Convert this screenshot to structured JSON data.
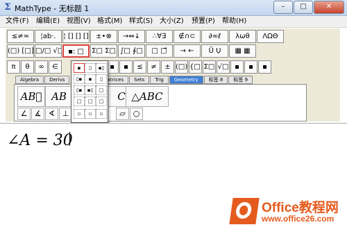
{
  "window": {
    "app_icon": "Σ",
    "title": "MathType - 无标题 1",
    "controls": [
      "–",
      "□",
      "✕"
    ]
  },
  "menu": [
    "文件(F)",
    "编辑(E)",
    "视图(V)",
    "格式(M)",
    "样式(S)",
    "大小(Z)",
    "预置(P)",
    "帮助(H)"
  ],
  "toolbar": {
    "row1": [
      "≤≠≈",
      "¦ab·.",
      "¦ [] [] [] ",
      "±•⊗",
      "→⇔↓",
      "∴∀∃",
      "∉∩⊂",
      "∂∞ℓ",
      "λωθ",
      "ΛΩΘ"
    ],
    "row2": [
      "(□) [□]",
      "□/□ √□",
      "▪: □",
      "Σ□ Σ□",
      "∫□ ∮□",
      "□ □⃗",
      "→ ←",
      "Ũ Ụ",
      "▦ ▦"
    ],
    "row3": [
      "π",
      "θ",
      "∞",
      "∈",
      "▪",
      "▪",
      "≤",
      "≠",
      "±",
      "(□)",
      "{□}",
      "Σ□",
      "√□",
      "▪",
      "▪",
      "▪"
    ],
    "tabs": [
      "Algebra",
      "Derivs",
      "Matrices",
      "Sets",
      "Trig",
      "Geometry",
      "标签 8",
      "标签 9"
    ],
    "active_tab": "Geometry",
    "templates": [
      "AB⃗",
      "AB",
      "C",
      "△ABC"
    ],
    "small_templates": [
      "∠",
      "∡",
      "∢",
      "⊥",
      "∥",
      "▱",
      "○"
    ]
  },
  "dropdown": {
    "items": [
      "▪",
      "▯",
      "▪▯",
      "▯▪",
      "▪",
      "▯",
      "▯▪",
      "▪▯",
      "□",
      "□",
      "□",
      "□",
      "▫",
      "▫",
      "▫"
    ]
  },
  "editor": {
    "equation": "∠A = 30"
  },
  "watermark": {
    "brand": "Office教程网",
    "url": "www.office26.com"
  },
  "colors": {
    "accent": "#e55b1e",
    "active_tab": "#3f7fd6",
    "selection": "#d44"
  }
}
